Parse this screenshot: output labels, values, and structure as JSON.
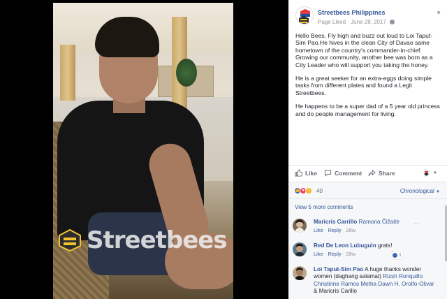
{
  "page": {
    "name": "Streetbees Philippines",
    "status": "Page Liked",
    "separator": "·",
    "date": "June 28, 2017",
    "brand_color": "#365899"
  },
  "post": {
    "paragraphs": [
      "Hello Bees, Fly high and buzz out loud to Loi Taput-Sim Pao.He hives in the clean City of Davao same hometown of the country's commander-in-chief. Growing our community, another bee was born as a City Leader who will support you taking the honey.",
      "He is a great seeker for an extra-eggs doing simple tasks from different plates and found a Legit Streetbees.",
      "He happens to be a super dad of a 5 year old princess and do people management for living."
    ]
  },
  "actions": {
    "like": "Like",
    "comment": "Comment",
    "share": "Share"
  },
  "reactions": {
    "count": "40",
    "icons": [
      "like-reaction-icon",
      "love-reaction-icon",
      "haha-reaction-icon"
    ],
    "sort": "Chronological"
  },
  "comments": {
    "view_more": "View 5 more comments",
    "items": [
      {
        "author": "Maricris Carrillo",
        "text": "",
        "tags": "Ramona Čižaitė",
        "like": "Like",
        "reply": "Reply",
        "time": "28w",
        "likes": ""
      },
      {
        "author": "Red De Leon Lubuguin",
        "text": "grats!",
        "tags": "",
        "like": "Like",
        "reply": "Reply",
        "time": "28w",
        "likes": "1"
      },
      {
        "author": "Loi Taput-Sim Pao",
        "text": "A huge thanks wonder women (daghang salamat)",
        "tags": "Rizsh Ronquillo Christinne Ramos Metha Dawn H. Orolfo-Olivar",
        "tail": "& Maricris Carillo"
      }
    ]
  },
  "watermark": {
    "text": "Streetbees"
  }
}
